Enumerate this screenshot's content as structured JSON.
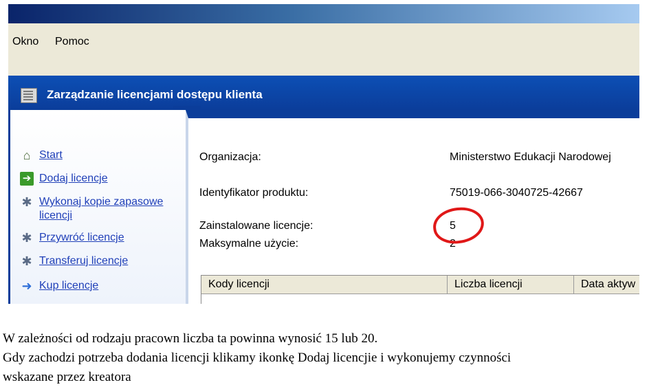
{
  "menu": {
    "okno": "Okno",
    "pomoc": "Pomoc"
  },
  "console": {
    "title": "Zarządzanie licencjami dostępu klienta"
  },
  "tasks": [
    {
      "label": "Start",
      "icon": "home-icon"
    },
    {
      "label": "Dodaj licencje",
      "icon": "add-arrow-icon"
    },
    {
      "label": "Wykonaj kopie zapasowe licencji",
      "icon": "tools-icon"
    },
    {
      "label": "Przywróć licencje",
      "icon": "tools-icon"
    },
    {
      "label": "Transferuj licencje",
      "icon": "tools-icon"
    },
    {
      "label": "Kup licencje",
      "icon": "arrow-right-icon"
    }
  ],
  "details": {
    "organization_label": "Organizacja:",
    "organization_value": "Ministerstwo Edukacji Narodowej",
    "product_id_label": "Identyfikator produktu:",
    "product_id_value": "75019-066-3040725-42667",
    "installed_label": "Zainstalowane licencje:",
    "installed_value": "5",
    "max_usage_label": "Maksymalne użycie:",
    "max_usage_value": "2"
  },
  "table": {
    "headers": [
      "Kody licencji",
      "Liczba licencji",
      "Data aktyw"
    ]
  },
  "caption": {
    "line1": "W zależności od rodzaju pracown liczba ta powinna wynosić 15 lub 20.",
    "line2": "Gdy zachodzi potrzeba dodania licencji klikamy ikonkę Dodaj licencjie i wykonujemy czynności",
    "line3": "wskazane przez kreatora"
  },
  "colors": {
    "header_blue": "#0b3d9a",
    "link_blue": "#1f3fb8",
    "annotation_red": "#e01818"
  }
}
